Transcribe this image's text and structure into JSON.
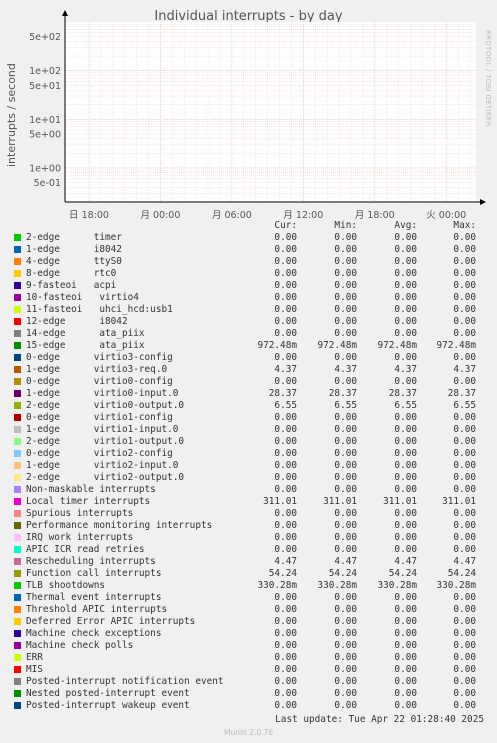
{
  "title": "Individual interrupts - by day",
  "side_text": "RRDTOOL / TOBI OETIKER",
  "last_update": "Last update: Tue Apr 22 01:28:40 2025",
  "version": "Munin 2.0.76",
  "columns": [
    "Cur:",
    "Min:",
    "Avg:",
    "Max:"
  ],
  "chart_data": {
    "type": "line",
    "title": "Individual interrupts - by day",
    "ylabel": "interrupts / second",
    "yscale": "log",
    "ylim": [
      0.2,
      1000
    ],
    "yticks": [
      "5e-01",
      "1e+00",
      "5e+00",
      "1e+01",
      "5e+01",
      "1e+02",
      "5e+02"
    ],
    "ytick_values": [
      0.5,
      1,
      5,
      10,
      50,
      100,
      500
    ],
    "xticks": [
      "日 18:00",
      "月 00:00",
      "月 06:00",
      "月 12:00",
      "月 18:00",
      "火 00:00"
    ],
    "grid": true,
    "series": [
      {
        "name": "2-edge      timer",
        "color": "#00cc00",
        "cur": "0.00",
        "min": "0.00",
        "avg": "0.00",
        "max": "0.00"
      },
      {
        "name": "1-edge      i8042",
        "color": "#0066b3",
        "cur": "0.00",
        "min": "0.00",
        "avg": "0.00",
        "max": "0.00"
      },
      {
        "name": "4-edge      ttyS0",
        "color": "#ff8000",
        "cur": "0.00",
        "min": "0.00",
        "avg": "0.00",
        "max": "0.00"
      },
      {
        "name": "8-edge      rtc0",
        "color": "#ffcc00",
        "cur": "0.00",
        "min": "0.00",
        "avg": "0.00",
        "max": "0.00"
      },
      {
        "name": "9-fasteoi   acpi",
        "color": "#330099",
        "cur": "0.00",
        "min": "0.00",
        "avg": "0.00",
        "max": "0.00"
      },
      {
        "name": "10-fasteoi   virtio4",
        "color": "#990099",
        "cur": "0.00",
        "min": "0.00",
        "avg": "0.00",
        "max": "0.00"
      },
      {
        "name": "11-fasteoi   uhci_hcd:usb1",
        "color": "#ccff00",
        "cur": "0.00",
        "min": "0.00",
        "avg": "0.00",
        "max": "0.00"
      },
      {
        "name": "12-edge      i8042",
        "color": "#ff0000",
        "cur": "0.00",
        "min": "0.00",
        "avg": "0.00",
        "max": "0.00"
      },
      {
        "name": "14-edge      ata_piix",
        "color": "#808080",
        "cur": "0.00",
        "min": "0.00",
        "avg": "0.00",
        "max": "0.00"
      },
      {
        "name": "15-edge      ata_piix",
        "color": "#008f00",
        "cur": "972.48m",
        "min": "972.48m",
        "avg": "972.48m",
        "max": "972.48m"
      },
      {
        "name": "0-edge      virtio3-config",
        "color": "#00487d",
        "cur": "0.00",
        "min": "0.00",
        "avg": "0.00",
        "max": "0.00"
      },
      {
        "name": "1-edge      virtio3-req.0",
        "color": "#b35a00",
        "cur": "4.37",
        "min": "4.37",
        "avg": "4.37",
        "max": "4.37"
      },
      {
        "name": "0-edge      virtio0-config",
        "color": "#b38f00",
        "cur": "0.00",
        "min": "0.00",
        "avg": "0.00",
        "max": "0.00"
      },
      {
        "name": "1-edge      virtio0-input.0",
        "color": "#6b006b",
        "cur": "28.37",
        "min": "28.37",
        "avg": "28.37",
        "max": "28.37"
      },
      {
        "name": "2-edge      virtio0-output.0",
        "color": "#8fb300",
        "cur": "6.55",
        "min": "6.55",
        "avg": "6.55",
        "max": "6.55"
      },
      {
        "name": "0-edge      virtio1-config",
        "color": "#b30000",
        "cur": "0.00",
        "min": "0.00",
        "avg": "0.00",
        "max": "0.00"
      },
      {
        "name": "1-edge      virtio1-input.0",
        "color": "#bebebe",
        "cur": "0.00",
        "min": "0.00",
        "avg": "0.00",
        "max": "0.00"
      },
      {
        "name": "2-edge      virtio1-output.0",
        "color": "#80ff80",
        "cur": "0.00",
        "min": "0.00",
        "avg": "0.00",
        "max": "0.00"
      },
      {
        "name": "0-edge      virtio2-config",
        "color": "#80c9ff",
        "cur": "0.00",
        "min": "0.00",
        "avg": "0.00",
        "max": "0.00"
      },
      {
        "name": "1-edge      virtio2-input.0",
        "color": "#ffc080",
        "cur": "0.00",
        "min": "0.00",
        "avg": "0.00",
        "max": "0.00"
      },
      {
        "name": "2-edge      virtio2-output.0",
        "color": "#ffe680",
        "cur": "0.00",
        "min": "0.00",
        "avg": "0.00",
        "max": "0.00"
      },
      {
        "name": "Non-maskable interrupts",
        "color": "#aa80ff",
        "cur": "0.00",
        "min": "0.00",
        "avg": "0.00",
        "max": "0.00"
      },
      {
        "name": "Local timer interrupts",
        "color": "#ee00cc",
        "cur": "311.01",
        "min": "311.01",
        "avg": "311.01",
        "max": "311.01"
      },
      {
        "name": "Spurious interrupts",
        "color": "#ff8080",
        "cur": "0.00",
        "min": "0.00",
        "avg": "0.00",
        "max": "0.00"
      },
      {
        "name": "Performance monitoring interrupts",
        "color": "#666600",
        "cur": "0.00",
        "min": "0.00",
        "avg": "0.00",
        "max": "0.00"
      },
      {
        "name": "IRQ work interrupts",
        "color": "#ffbfff",
        "cur": "0.00",
        "min": "0.00",
        "avg": "0.00",
        "max": "0.00"
      },
      {
        "name": "APIC ICR read retries",
        "color": "#00ffcc",
        "cur": "0.00",
        "min": "0.00",
        "avg": "0.00",
        "max": "0.00"
      },
      {
        "name": "Rescheduling interrupts",
        "color": "#cc6699",
        "cur": "4.47",
        "min": "4.47",
        "avg": "4.47",
        "max": "4.47"
      },
      {
        "name": "Function call interrupts",
        "color": "#999900",
        "cur": "54.24",
        "min": "54.24",
        "avg": "54.24",
        "max": "54.24"
      },
      {
        "name": "TLB shootdowns",
        "color": "#00cc00",
        "cur": "330.28m",
        "min": "330.28m",
        "avg": "330.28m",
        "max": "330.28m"
      },
      {
        "name": "Thermal event interrupts",
        "color": "#0066b3",
        "cur": "0.00",
        "min": "0.00",
        "avg": "0.00",
        "max": "0.00"
      },
      {
        "name": "Threshold APIC interrupts",
        "color": "#ff8000",
        "cur": "0.00",
        "min": "0.00",
        "avg": "0.00",
        "max": "0.00"
      },
      {
        "name": "Deferred Error APIC interrupts",
        "color": "#ffcc00",
        "cur": "0.00",
        "min": "0.00",
        "avg": "0.00",
        "max": "0.00"
      },
      {
        "name": "Machine check exceptions",
        "color": "#330099",
        "cur": "0.00",
        "min": "0.00",
        "avg": "0.00",
        "max": "0.00"
      },
      {
        "name": "Machine check polls",
        "color": "#990099",
        "cur": "0.00",
        "min": "0.00",
        "avg": "0.00",
        "max": "0.00"
      },
      {
        "name": "ERR",
        "color": "#ccff00",
        "cur": "0.00",
        "min": "0.00",
        "avg": "0.00",
        "max": "0.00"
      },
      {
        "name": "MIS",
        "color": "#ff0000",
        "cur": "0.00",
        "min": "0.00",
        "avg": "0.00",
        "max": "0.00"
      },
      {
        "name": "Posted-interrupt notification event",
        "color": "#808080",
        "cur": "0.00",
        "min": "0.00",
        "avg": "0.00",
        "max": "0.00"
      },
      {
        "name": "Nested posted-interrupt event",
        "color": "#008f00",
        "cur": "0.00",
        "min": "0.00",
        "avg": "0.00",
        "max": "0.00"
      },
      {
        "name": "Posted-interrupt wakeup event",
        "color": "#00487d",
        "cur": "0.00",
        "min": "0.00",
        "avg": "0.00",
        "max": "0.00"
      }
    ]
  }
}
